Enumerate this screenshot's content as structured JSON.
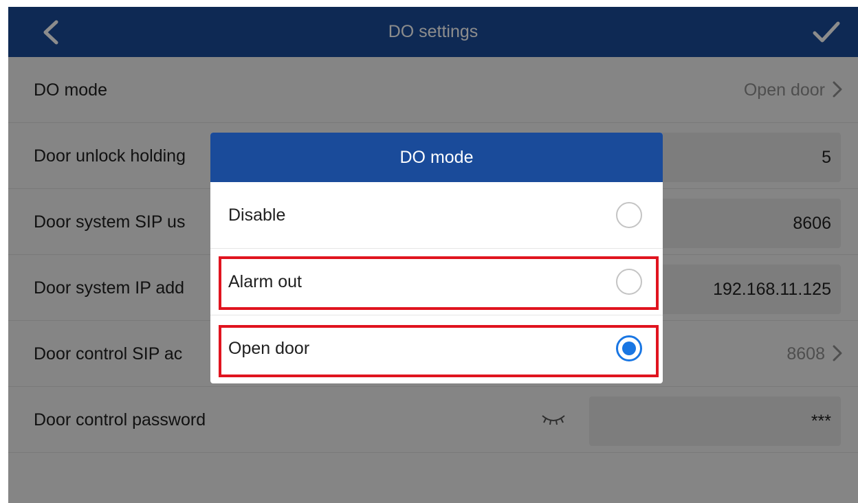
{
  "header": {
    "title": "DO settings",
    "back_icon": "chevron-left-icon",
    "confirm_icon": "check-icon"
  },
  "rows": [
    {
      "label": "DO mode",
      "value": "Open door"
    },
    {
      "label": "Door unlock holding",
      "value": "5"
    },
    {
      "label": "Door system SIP us",
      "value": "8606"
    },
    {
      "label": "Door system IP add",
      "value": "192.168.11.125"
    },
    {
      "label": "Door control SIP ac",
      "value": "8608"
    },
    {
      "label": "Door control password",
      "value": "***"
    }
  ],
  "dialog": {
    "title": "DO mode",
    "options": [
      {
        "label": "Disable",
        "selected": false
      },
      {
        "label": "Alarm out",
        "selected": false
      },
      {
        "label": "Open door",
        "selected": true
      }
    ]
  },
  "colors": {
    "header_bg": "#1a4b9a",
    "radio_selected": "#1976e3",
    "highlight_border": "#e0141f"
  }
}
